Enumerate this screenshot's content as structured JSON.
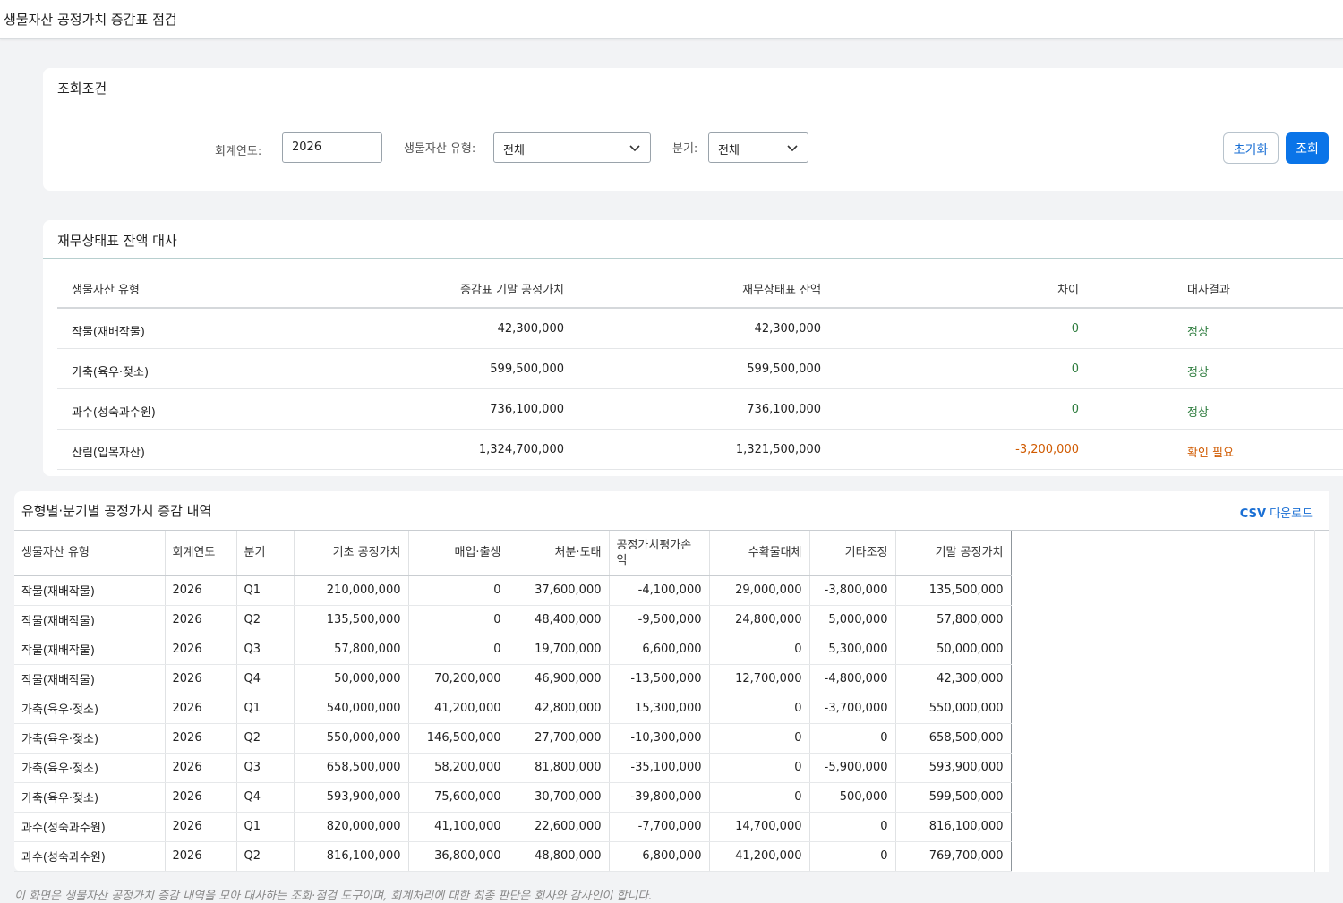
{
  "app": {
    "title": "생물자산 공정가치 증감표 점검"
  },
  "search": {
    "title": "조회조건",
    "year_label": "회계연도:",
    "year_value": "2026",
    "type_label": "생물자산 유형:",
    "type_value": "전체",
    "quarter_label": "분기:",
    "quarter_value": "전체",
    "reset_label": "초기화",
    "search_label": "조회"
  },
  "recon": {
    "title": "재무상태표 잔액 대사",
    "headers": [
      "생물자산 유형",
      "증감표 기말 공정가치",
      "재무상태표 잔액",
      "차이",
      "대사결과"
    ],
    "rows": [
      {
        "type": "작물(재배작물)",
        "closing": "42,300,000",
        "bs": "42,300,000",
        "diff": "0",
        "result": "정상",
        "status": "ok"
      },
      {
        "type": "가축(육우·젖소)",
        "closing": "599,500,000",
        "bs": "599,500,000",
        "diff": "0",
        "result": "정상",
        "status": "ok"
      },
      {
        "type": "과수(성숙과수원)",
        "closing": "736,100,000",
        "bs": "736,100,000",
        "diff": "0",
        "result": "정상",
        "status": "ok"
      },
      {
        "type": "산림(입목자산)",
        "closing": "1,324,700,000",
        "bs": "1,321,500,000",
        "diff": "-3,200,000",
        "result": "확인 필요",
        "status": "warn"
      }
    ],
    "colors": {
      "ok": "#2f7d3f",
      "warn": "#d05a00"
    }
  },
  "detail": {
    "title": "유형별·분기별 공정가치 증감 내역",
    "csv_prefix": "CSV",
    "csv_suffix": " 다운로드",
    "headers": [
      "생물자산 유형",
      "회계연도",
      "분기",
      "기초 공정가치",
      "매입·출생",
      "처분·도태",
      "공정가치평가손익",
      "수확물대체",
      "기타조정",
      "기말 공정가치"
    ],
    "rows": [
      [
        "작물(재배작물)",
        "2026",
        "Q1",
        "210,000,000",
        "0",
        "37,600,000",
        "-4,100,000",
        "29,000,000",
        "-3,800,000",
        "135,500,000"
      ],
      [
        "작물(재배작물)",
        "2026",
        "Q2",
        "135,500,000",
        "0",
        "48,400,000",
        "-9,500,000",
        "24,800,000",
        "5,000,000",
        "57,800,000"
      ],
      [
        "작물(재배작물)",
        "2026",
        "Q3",
        "57,800,000",
        "0",
        "19,700,000",
        "6,600,000",
        "0",
        "5,300,000",
        "50,000,000"
      ],
      [
        "작물(재배작물)",
        "2026",
        "Q4",
        "50,000,000",
        "70,200,000",
        "46,900,000",
        "-13,500,000",
        "12,700,000",
        "-4,800,000",
        "42,300,000"
      ],
      [
        "가축(육우·젖소)",
        "2026",
        "Q1",
        "540,000,000",
        "41,200,000",
        "42,800,000",
        "15,300,000",
        "0",
        "-3,700,000",
        "550,000,000"
      ],
      [
        "가축(육우·젖소)",
        "2026",
        "Q2",
        "550,000,000",
        "146,500,000",
        "27,700,000",
        "-10,300,000",
        "0",
        "0",
        "658,500,000"
      ],
      [
        "가축(육우·젖소)",
        "2026",
        "Q3",
        "658,500,000",
        "58,200,000",
        "81,800,000",
        "-35,100,000",
        "0",
        "-5,900,000",
        "593,900,000"
      ],
      [
        "가축(육우·젖소)",
        "2026",
        "Q4",
        "593,900,000",
        "75,600,000",
        "30,700,000",
        "-39,800,000",
        "0",
        "500,000",
        "599,500,000"
      ],
      [
        "과수(성숙과수원)",
        "2026",
        "Q1",
        "820,000,000",
        "41,100,000",
        "22,600,000",
        "-7,700,000",
        "14,700,000",
        "0",
        "816,100,000"
      ],
      [
        "과수(성숙과수원)",
        "2026",
        "Q2",
        "816,100,000",
        "36,800,000",
        "48,800,000",
        "6,800,000",
        "41,200,000",
        "0",
        "769,700,000"
      ]
    ]
  },
  "footnote": "이 화면은 생물자산 공정가치 증감 내역을 모아 대사하는 조회·점검 도구이며, 회계처리에 대한 최종 판단은 회사와 감사인이 합니다."
}
